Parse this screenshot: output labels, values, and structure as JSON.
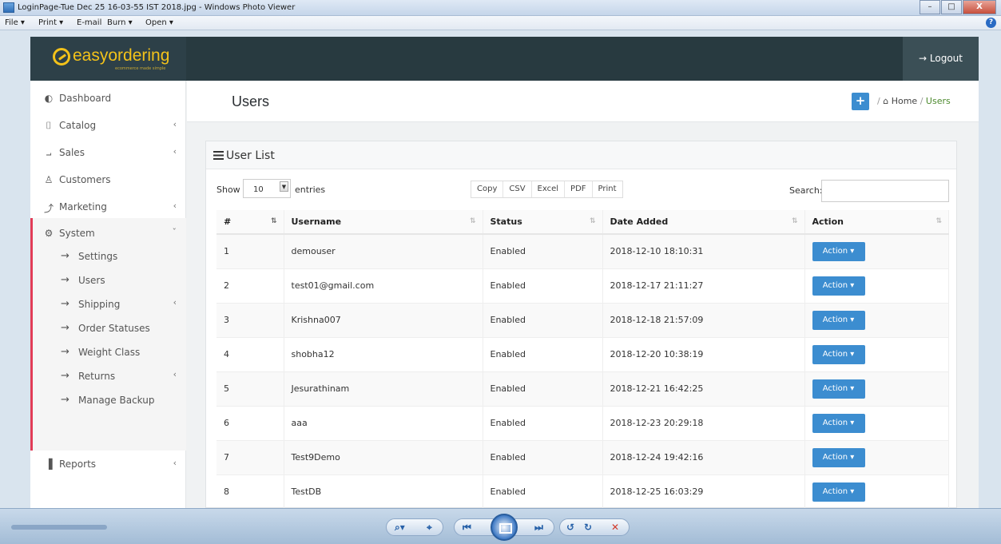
{
  "window": {
    "title": "LoginPage-Tue Dec 25 16-03-55 IST 2018.jpg - Windows Photo Viewer",
    "min": "–",
    "max": "□",
    "close": "X"
  },
  "viewer_menu": {
    "file": "File ▾",
    "print": "Print ▾",
    "email": "E-mail",
    "burn": "Burn ▾",
    "open": "Open ▾",
    "help": "?"
  },
  "header": {
    "logo": "easyordering",
    "tagline": "ecommerce made simple",
    "logout_label": "→ Logout"
  },
  "sidebar": {
    "items": [
      {
        "label": "Dashboard",
        "icon": "dashboard-icon",
        "glyph": "◐"
      },
      {
        "label": "Catalog",
        "icon": "tag-icon",
        "glyph": "⌷",
        "chev": "‹"
      },
      {
        "label": "Sales",
        "icon": "cart-icon",
        "glyph": "⨼",
        "chev": "‹"
      },
      {
        "label": "Customers",
        "icon": "user-icon",
        "glyph": "♙"
      },
      {
        "label": "Marketing",
        "icon": "share-icon",
        "glyph": "⤴",
        "chev": "‹"
      },
      {
        "label": "System",
        "icon": "gear-icon",
        "glyph": "⚙",
        "chev": "ˇ"
      },
      {
        "label": "Reports",
        "icon": "bar-chart-icon",
        "glyph": "▐",
        "chev": "‹"
      }
    ],
    "system_sub": [
      {
        "label": "Settings"
      },
      {
        "label": "Users"
      },
      {
        "label": "Shipping",
        "chev": "‹"
      },
      {
        "label": "Order Statuses"
      },
      {
        "label": "Weight Class"
      },
      {
        "label": "Returns",
        "chev": "‹"
      },
      {
        "label": "Manage Backup"
      }
    ],
    "arrow": "→"
  },
  "content": {
    "page_title": "Users",
    "add_label": "+",
    "breadcrumb": {
      "sep": "/",
      "home": "⌂ Home",
      "current": "Users"
    }
  },
  "panel": {
    "title": "User List",
    "show_label": "Show",
    "length_value": "10",
    "entries_label": "entries",
    "export_buttons": [
      "Copy",
      "CSV",
      "Excel",
      "PDF",
      "Print"
    ],
    "search_label": "Search:",
    "search_value": ""
  },
  "table": {
    "columns": [
      "#",
      "Username",
      "Status",
      "Date Added",
      "Action"
    ],
    "action_label": "Action ▾",
    "rows": [
      {
        "id": "1",
        "username": "demouser",
        "status": "Enabled",
        "date": "2018-12-10 18:10:31"
      },
      {
        "id": "2",
        "username": "test01@gmail.com",
        "status": "Enabled",
        "date": "2018-12-17 21:11:27"
      },
      {
        "id": "3",
        "username": "Krishna007",
        "status": "Enabled",
        "date": "2018-12-18 21:57:09"
      },
      {
        "id": "4",
        "username": "shobha12",
        "status": "Enabled",
        "date": "2018-12-20 10:38:19"
      },
      {
        "id": "5",
        "username": "Jesurathinam",
        "status": "Enabled",
        "date": "2018-12-21 16:42:25"
      },
      {
        "id": "6",
        "username": "aaa",
        "status": "Enabled",
        "date": "2018-12-23 20:29:18"
      },
      {
        "id": "7",
        "username": "Test9Demo",
        "status": "Enabled",
        "date": "2018-12-24 19:42:16"
      },
      {
        "id": "8",
        "username": "TestDB",
        "status": "Enabled",
        "date": "2018-12-25 16:03:29"
      }
    ]
  },
  "viewer_toolbar": {
    "zoom": "⌕▾",
    "actual_size": "⌖",
    "prev": "⏮",
    "next": "⏭",
    "rotate_ccw": "↺",
    "rotate_cw": "↻",
    "delete": "✕"
  },
  "colors": {
    "header_bg": "#283a40",
    "logo": "#f3c21a",
    "accent": "#3c8dd0",
    "system_marker": "#e23c57",
    "breadcrumb_current": "#4d8a2e"
  }
}
